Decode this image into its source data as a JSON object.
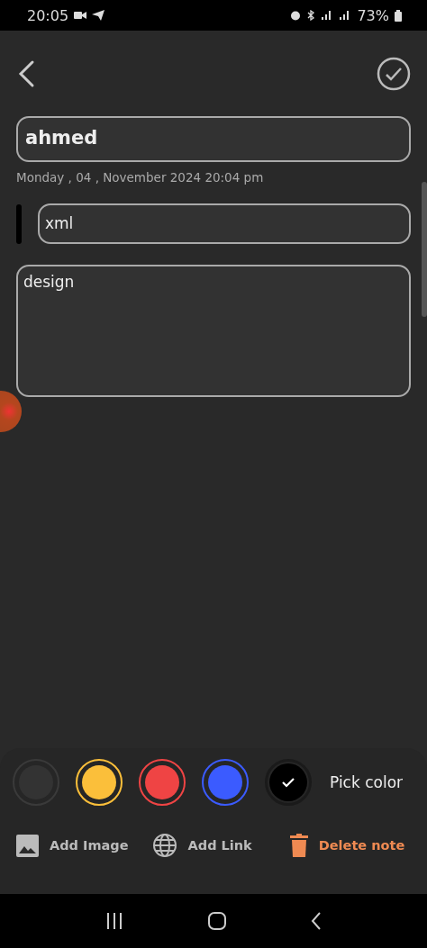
{
  "status_bar": {
    "time": "20:05",
    "battery": "73%"
  },
  "note": {
    "title": "ahmed",
    "date": "Monday , 04 , November 2024 20:04 pm",
    "category": "xml",
    "body": "design"
  },
  "colors": [
    {
      "color": "#333333",
      "selected": false
    },
    {
      "color": "#fbbf3a",
      "selected": false
    },
    {
      "color": "#ef4444",
      "selected": false
    },
    {
      "color": "#3b5bff",
      "selected": false
    },
    {
      "color": "#000000",
      "selected": true
    }
  ],
  "pick_color_label": "Pick color",
  "actions": [
    {
      "kind": "image",
      "label": "Add Image"
    },
    {
      "kind": "link",
      "label": "Add Link"
    },
    {
      "kind": "delete",
      "label": "Delete note"
    }
  ]
}
